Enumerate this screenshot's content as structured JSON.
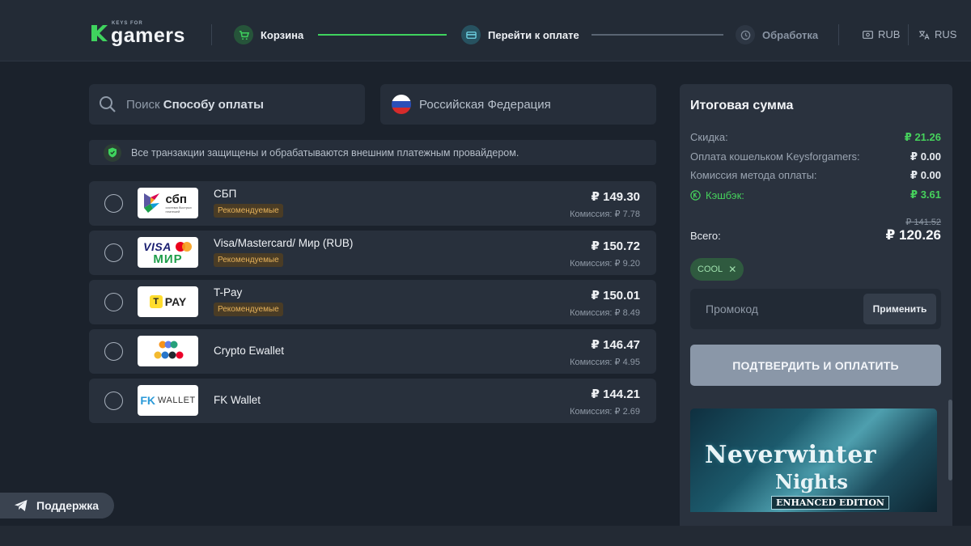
{
  "header": {
    "logo_small": "KEYS FOR",
    "logo_text": "gamers",
    "steps": [
      {
        "label": "Корзина",
        "state": "done"
      },
      {
        "label": "Перейти к оплате",
        "state": "active"
      },
      {
        "label": "Обработка",
        "state": "pending"
      }
    ],
    "currency": "RUB",
    "language": "RUS"
  },
  "search": {
    "placeholder_prefix": "Поиск ",
    "placeholder_bold": "Способу оплаты"
  },
  "country": "Российская Федерация",
  "secure_note": "Все транзакции защищены и обрабатываются внешним платежным провайдером.",
  "methods": [
    {
      "name": "СБП",
      "badge": "Рекомендуемые",
      "price": "₽ 149.30",
      "fee": "Комиссия: ₽ 7.78",
      "logo": "sbp-logo"
    },
    {
      "name": "Visa/Mastercard/ Мир (RUB)",
      "badge": "Рекомендуемые",
      "price": "₽ 150.72",
      "fee": "Комиссия: ₽ 9.20",
      "logo": "visa-mir-logo"
    },
    {
      "name": "T-Pay",
      "badge": "Рекомендуемые",
      "price": "₽ 150.01",
      "fee": "Комиссия: ₽ 8.49",
      "logo": "tpay-logo"
    },
    {
      "name": "Crypto Ewallet",
      "badge": "",
      "price": "₽ 146.47",
      "fee": "Комиссия: ₽ 4.95",
      "logo": "crypto-logo"
    },
    {
      "name": "FK Wallet",
      "badge": "",
      "price": "₽ 144.21",
      "fee": "Комиссия: ₽ 2.69",
      "logo": "fk-wallet-logo"
    }
  ],
  "logos": {
    "sbp_text": "сбп",
    "sbp_sub": "система быстрых платежей",
    "visa": "VISA",
    "mir": "МИР",
    "tpay": "PAY",
    "tpay_mark": "T",
    "fk": "FK",
    "fk_wallet": "WALLET"
  },
  "summary": {
    "title": "Итоговая сумма",
    "discount_label": "Скидка:",
    "discount_value": "₽ 21.26",
    "wallet_label": "Оплата кошельком Keysforgamers:",
    "wallet_value": "₽ 0.00",
    "fee_label": "Комиссия метода оплаты:",
    "fee_value": "₽ 0.00",
    "cashback_label": "Кэшбэк:",
    "cashback_value": "₽ 3.61",
    "old_total": "₽ 141.52",
    "total_label": "Всего:",
    "total_value": "₽ 120.26",
    "coupon": "COOL",
    "promo_placeholder": "Промокод",
    "apply_label": "Применить",
    "confirm_label": "ПОДТВЕРДИТЬ И ОПЛАТИТЬ"
  },
  "game": {
    "title_line1": "Neverwinter",
    "title_line2": "Nights",
    "edition": "ENHANCED EDITION"
  },
  "support_label": "Поддержка",
  "colors": {
    "accent_green": "#3fd35e",
    "badge_bg": "#4a3c25",
    "badge_text": "#e6b25a"
  }
}
